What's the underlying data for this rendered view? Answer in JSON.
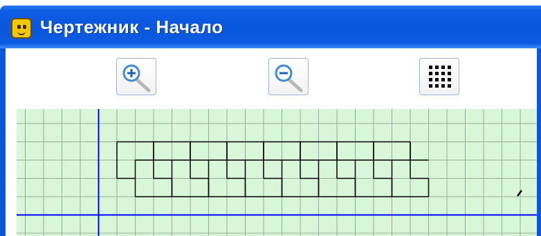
{
  "window": {
    "title": "Чертежник - Начало",
    "app_icon": "smiley-app-icon"
  },
  "toolbar": {
    "buttons": [
      {
        "name": "zoom-in",
        "icon": "magnifier-plus-icon"
      },
      {
        "name": "zoom-out",
        "icon": "magnifier-minus-icon"
      },
      {
        "name": "toggle-grid",
        "icon": "dot-grid-icon"
      }
    ]
  },
  "canvas": {
    "grid_visible": true,
    "colors": {
      "background": "#d8f6d8",
      "grid_line": "#9aa99a",
      "axis": "#0000ff",
      "drawing": "#000000"
    }
  }
}
